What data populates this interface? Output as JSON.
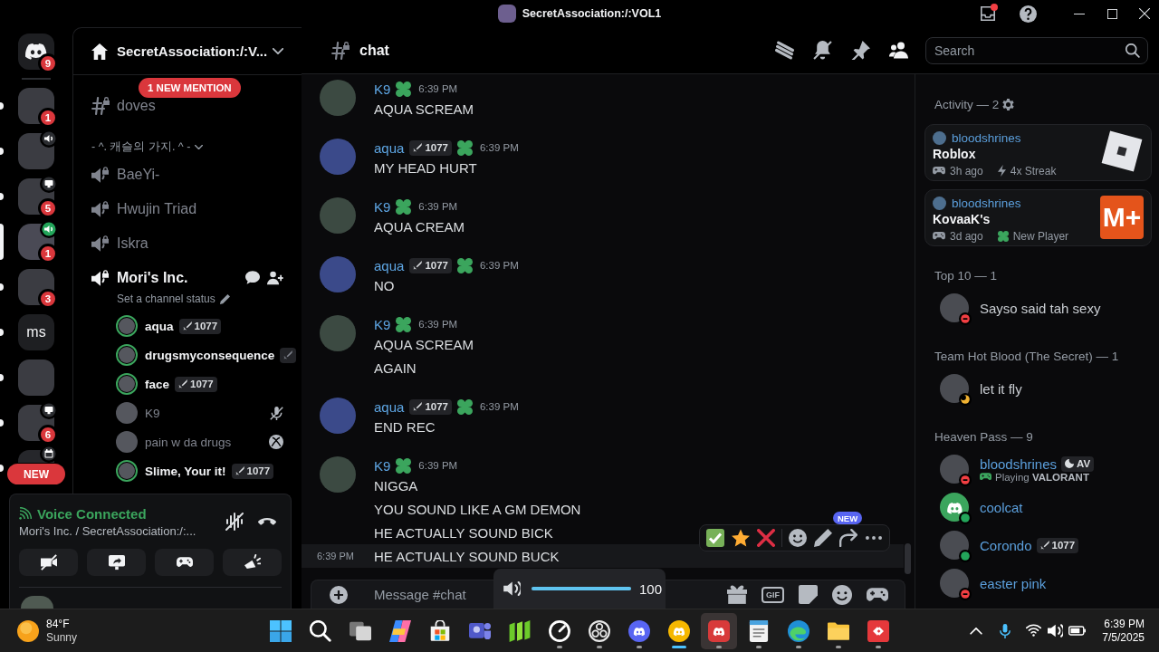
{
  "window": {
    "title": "SecretAssociation:/:VOL1",
    "inbox_unread": true
  },
  "rail": {
    "home_badge": "9",
    "servers": [
      {
        "kind": "photo",
        "badge": "1",
        "unread": true,
        "selected": false
      },
      {
        "kind": "photo",
        "activity": {
          "kind": "voice"
        },
        "unread": true,
        "selected": false
      },
      {
        "kind": "photo",
        "activity": {
          "kind": "stream"
        },
        "badge": "5",
        "unread": true,
        "selected": false
      },
      {
        "kind": "photo",
        "activity": {
          "kind": "voice-live"
        },
        "badge": "1",
        "unread": false,
        "selected": true
      },
      {
        "kind": "photo",
        "badge": "3",
        "unread": true,
        "selected": false
      },
      {
        "kind": "text",
        "label": "ms",
        "unread": true,
        "selected": false
      },
      {
        "kind": "photo",
        "unread": true,
        "selected": false
      },
      {
        "kind": "photo",
        "activity": {
          "kind": "stream"
        },
        "badge": "6",
        "unread": true,
        "selected": false
      },
      {
        "kind": "photo-covered",
        "activity": {
          "kind": "event"
        },
        "unread": true,
        "selected": false
      }
    ],
    "new_pill": "NEW"
  },
  "sidebar": {
    "server_name": "SecretAssociation:/:V...",
    "mention_pill": "1 NEW MENTION",
    "text_channels": [
      {
        "name": "doves",
        "locked": true
      }
    ],
    "category": {
      "name": "- ^. 캐슬의 가지. ^ -",
      "expanded": true
    },
    "voice_channels": [
      {
        "name": "BaeYi-",
        "locked": true,
        "connected": false
      },
      {
        "name": "Hwujin Triad",
        "locked": true,
        "connected": false
      },
      {
        "name": "Iskra",
        "locked": true,
        "connected": false
      },
      {
        "name": "Mori's Inc.",
        "locked": true,
        "connected": true,
        "status_hint": "Set a channel status",
        "members": [
          {
            "name": "aqua",
            "tag": {
              "kind": "sword",
              "text": "1077"
            },
            "speaking": true,
            "muted": false
          },
          {
            "name": "drugsmyconsequence",
            "tag": {
              "kind": "sword"
            },
            "speaking": true,
            "muted": false
          },
          {
            "name": "face",
            "tag": {
              "kind": "sword",
              "text": "1077"
            },
            "speaking": true,
            "muted": false
          },
          {
            "name": "K9",
            "speaking": false,
            "muted": true
          },
          {
            "name": "pain w da drugs",
            "speaking": false,
            "muted": false,
            "device": {
              "kind": "xbox"
            }
          },
          {
            "name": "Slime, Your it!",
            "tag": {
              "kind": "sword",
              "text": "1077"
            },
            "speaking": true,
            "muted": false
          }
        ]
      }
    ]
  },
  "voice": {
    "status": "Voice Connected",
    "location": "Mori's Inc. / SecretAssociation:/:...",
    "noise_suppression": false,
    "buttons": [
      {
        "kind": "camera-off"
      },
      {
        "kind": "screen-share"
      },
      {
        "kind": "activities"
      },
      {
        "kind": "soundboard"
      }
    ]
  },
  "chat": {
    "channel": "chat",
    "header_icons": [
      {
        "kind": "threads",
        "selected": false
      },
      {
        "kind": "mute",
        "selected": false
      },
      {
        "kind": "pins",
        "selected": false
      },
      {
        "kind": "members",
        "selected": true
      }
    ],
    "search_placeholder": "Search",
    "messages": [
      {
        "author": "K9",
        "has_badge": true,
        "time": "6:39 PM",
        "lines": [
          {
            "text": "AQUA SCREAM",
            "hovered": false
          }
        ]
      },
      {
        "author": "aqua",
        "tag": {
          "kind": "sword",
          "text": "1077"
        },
        "has_badge": true,
        "time": "6:39 PM",
        "lines": [
          {
            "text": "MY HEAD HURT",
            "hovered": false
          }
        ]
      },
      {
        "author": "K9",
        "has_badge": true,
        "time": "6:39 PM",
        "lines": [
          {
            "text": "AQUA CREAM",
            "hovered": false
          }
        ]
      },
      {
        "author": "aqua",
        "tag": {
          "kind": "sword",
          "text": "1077"
        },
        "has_badge": true,
        "time": "6:39 PM",
        "lines": [
          {
            "text": "NO",
            "hovered": false
          }
        ]
      },
      {
        "author": "K9",
        "has_badge": true,
        "time": "6:39 PM",
        "lines": [
          {
            "text": "AQUA SCREAM",
            "hovered": false
          },
          {
            "text": "AGAIN",
            "hovered": false
          }
        ]
      },
      {
        "author": "aqua",
        "tag": {
          "kind": "sword",
          "text": "1077"
        },
        "has_badge": true,
        "time": "6:39 PM",
        "lines": [
          {
            "text": "END REC",
            "hovered": false
          }
        ]
      },
      {
        "author": "K9",
        "has_badge": true,
        "time": "6:39 PM",
        "lines": [
          {
            "text": "NIGGA",
            "hovered": false
          },
          {
            "text": "YOU SOUND LIKE A GM DEMON",
            "hovered": false
          },
          {
            "text": "HE ACTUALLY SOUND BICK",
            "hovered": false
          },
          {
            "text": "HE ACTUALLY SOUND BUCK",
            "hovered": true,
            "time": "6:39 PM"
          }
        ]
      }
    ],
    "toolbar": {
      "reactions": [
        {
          "kind": "check"
        },
        {
          "kind": "star"
        },
        {
          "kind": "cross"
        }
      ],
      "actions": [
        {
          "kind": "add-reaction"
        },
        {
          "kind": "edit"
        },
        {
          "kind": "forward",
          "badge": "NEW"
        },
        {
          "kind": "more"
        }
      ]
    },
    "input": {
      "placeholder": "Message #chat",
      "gif_label": "GIF"
    },
    "volume": {
      "level": 1,
      "reading": "100"
    }
  },
  "members": {
    "activity_title": "Activity — 2",
    "activities": [
      {
        "user": "bloodshrines",
        "game": "Roblox",
        "time": "3h ago",
        "extra": {
          "kind": "streak",
          "text": "4x Streak"
        },
        "logo": {
          "kind": "roblox"
        }
      },
      {
        "user": "bloodshrines",
        "game": "KovaaK's",
        "time": "3d ago",
        "extra": {
          "kind": "new-player",
          "text": "New Player"
        },
        "logo": {
          "kind": "tile",
          "text": "M+"
        }
      }
    ],
    "groups": [
      {
        "title": "Top 10 — 1",
        "color": "#c9cdd2",
        "members": [
          {
            "name": "Sayso said tah sexy",
            "status": {
              "kind": "dnd"
            },
            "avatar": {
              "kind": "photo"
            }
          }
        ]
      },
      {
        "title": "Team Hot Blood (The Secret) — 1",
        "color": "#c9cdd2",
        "members": [
          {
            "name": "let it fly",
            "status": {
              "kind": "idle"
            },
            "avatar": {
              "kind": "photo"
            }
          }
        ]
      },
      {
        "title": "Heaven Pass — 9",
        "color": "#5b9fdc",
        "members": [
          {
            "name": "bloodshrines",
            "status": {
              "kind": "dnd"
            },
            "avatar": {
              "kind": "photo"
            },
            "tag": {
              "kind": "moon",
              "text": "AV"
            },
            "activity": "Playing **VALORANT**"
          },
          {
            "name": "coolcat",
            "status": {
              "kind": "online"
            },
            "avatar": {
              "kind": "default"
            }
          },
          {
            "name": "Corondo",
            "status": {
              "kind": "online"
            },
            "avatar": {
              "kind": "photo"
            },
            "tag": {
              "kind": "sword",
              "text": "1077"
            }
          },
          {
            "name": "easter pink",
            "status": {
              "kind": "dnd"
            },
            "avatar": {
              "kind": "photo"
            }
          }
        ]
      }
    ]
  },
  "taskbar": {
    "weather": {
      "temp": "84°F",
      "condition": "Sunny"
    },
    "apps": [
      {
        "kind": "start",
        "running": false,
        "focused": false,
        "hovered": false
      },
      {
        "kind": "search",
        "running": false,
        "focused": false,
        "hovered": false
      },
      {
        "kind": "task-view",
        "running": false,
        "focused": false,
        "hovered": false
      },
      {
        "kind": "swirl",
        "running": false,
        "focused": false,
        "hovered": false
      },
      {
        "kind": "bag",
        "running": false,
        "focused": false,
        "hovered": false
      },
      {
        "kind": "people-tile",
        "running": false,
        "focused": false,
        "hovered": false
      },
      {
        "kind": "bars-tile",
        "running": false,
        "focused": false,
        "hovered": false
      },
      {
        "kind": "gauge",
        "running": true,
        "focused": false,
        "hovered": false
      },
      {
        "kind": "ring",
        "running": true,
        "focused": false,
        "hovered": false
      },
      {
        "kind": "blurple-face",
        "running": true,
        "focused": false,
        "hovered": false
      },
      {
        "kind": "yellow-face",
        "running": true,
        "focused": true,
        "hovered": false
      },
      {
        "kind": "red-face",
        "running": true,
        "focused": false,
        "hovered": true
      },
      {
        "kind": "notepad",
        "running": true,
        "focused": false,
        "hovered": false
      },
      {
        "kind": "wave",
        "running": true,
        "focused": false,
        "hovered": false
      },
      {
        "kind": "folder",
        "running": true,
        "focused": false,
        "hovered": false
      },
      {
        "kind": "arrows-tile",
        "running": true,
        "focused": false,
        "hovered": false
      }
    ],
    "tray": [
      {
        "kind": "chevron"
      },
      {
        "kind": "mic"
      },
      {
        "kind": "wifi"
      },
      {
        "kind": "volume"
      },
      {
        "kind": "battery"
      }
    ],
    "time": "6:39 PM",
    "date": "7/5/2025"
  }
}
